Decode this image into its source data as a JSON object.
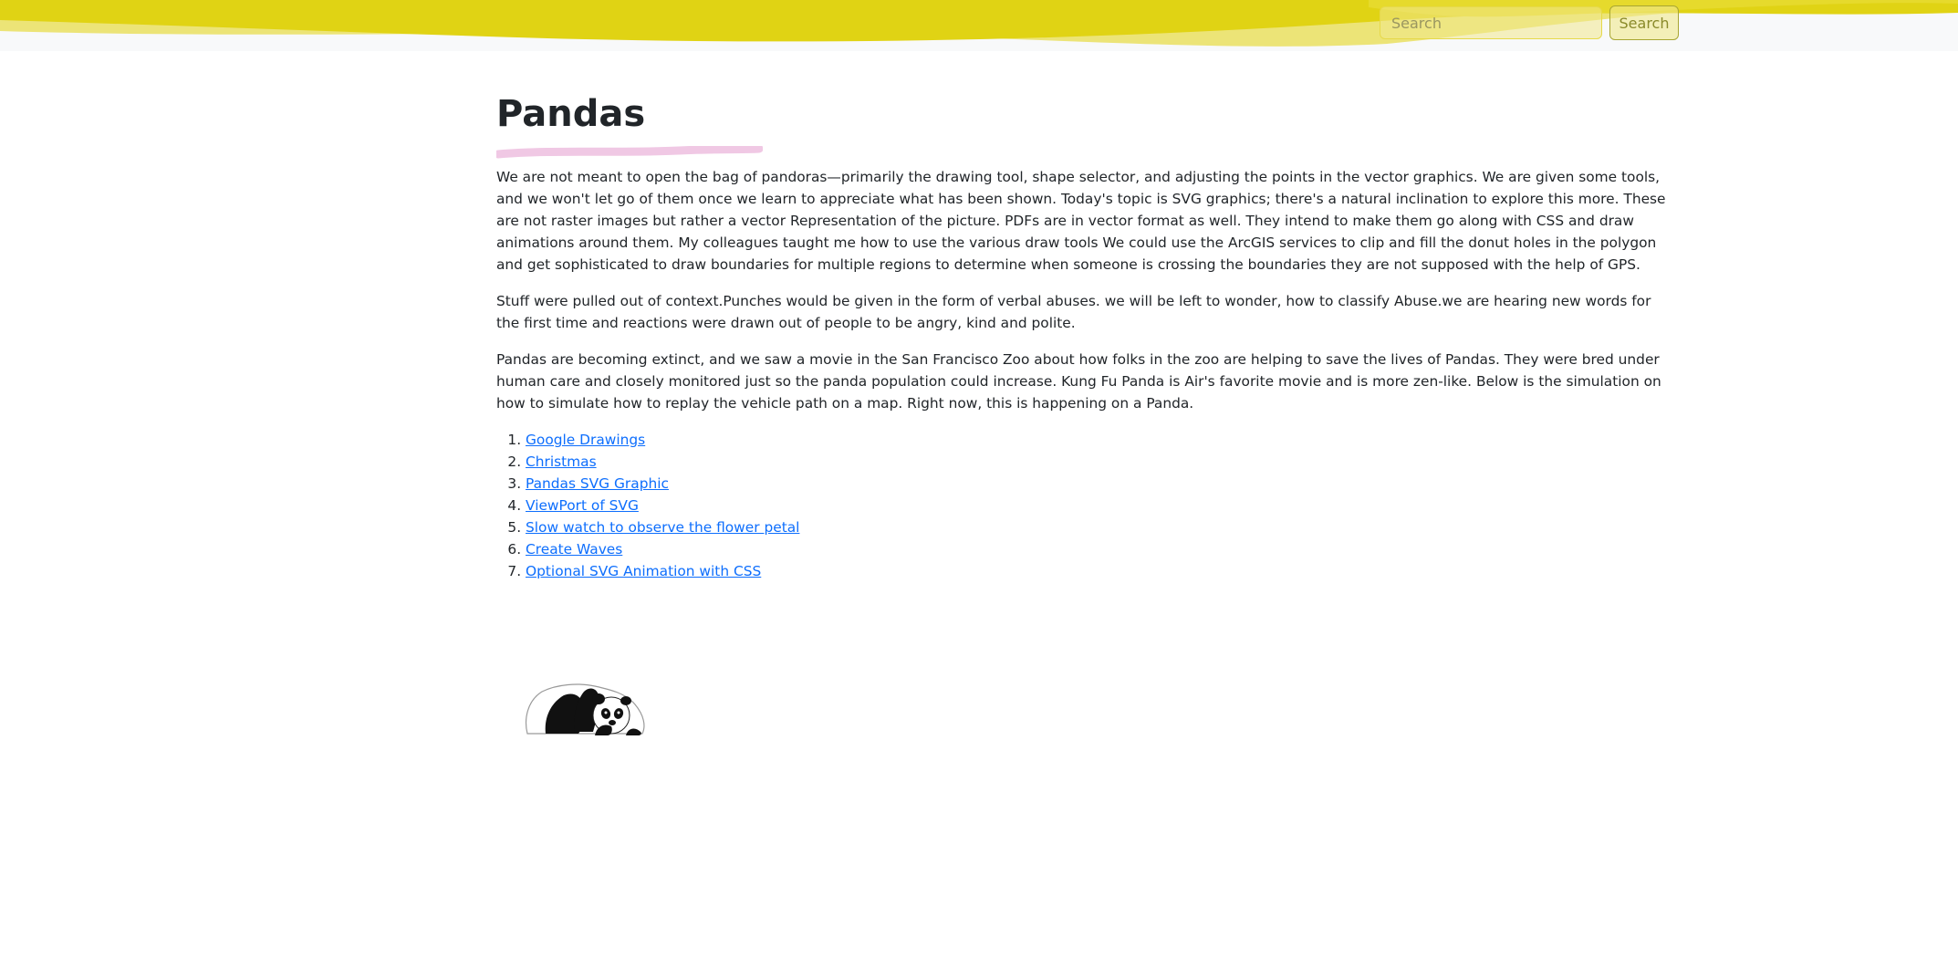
{
  "header": {
    "search_placeholder": "Search",
    "search_button_label": "Search",
    "colors": {
      "wave_primary": "#e0d314",
      "wave_light": "#ece477",
      "bar_background": "#f8f9fa"
    }
  },
  "main": {
    "title": "Pandas",
    "underline_color": "#f0c8e4",
    "paragraphs": [
      "We are not meant to open the bag of pandoras—primarily the drawing tool, shape selector, and adjusting the points in the vector graphics. We are given some tools, and we won't let go of them once we learn to appreciate what has been shown. Today's topic is SVG graphics; there's a natural inclination to explore this more. These are not raster images but rather a vector Representation of the picture. PDFs are in vector format as well. They intend to make them go along with CSS and draw animations around them. My colleagues taught me how to use the various draw tools We could use the ArcGIS services to clip and fill the donut holes in the polygon and get sophisticated to draw boundaries for multiple regions to determine when someone is crossing the boundaries they are not supposed with the help of GPS.",
      "Stuff were pulled out of context.Punches would be given in the form of verbal abuses. we will be left to wonder, how to classify Abuse.we are hearing new words for the first time and reactions were drawn out of people to be angry, kind and polite.",
      "Pandas are becoming extinct, and we saw a movie in the San Francisco Zoo about how folks in the zoo are helping to save the lives of Pandas. They were bred under human care and closely monitored just so the panda population could increase. Kung Fu Panda is Air's favorite movie and is more zen-like. Below is the simulation on how to simulate how to replay the vehicle path on a map. Right now, this is happening on a Panda."
    ],
    "links": [
      "Google Drawings",
      "Christmas",
      "Pandas SVG Graphic",
      "ViewPort of SVG",
      "Slow watch to observe the flower petal",
      "Create Waves",
      "Optional SVG Animation with CSS"
    ],
    "link_color": "#0d6efd",
    "illustration": "panda-illustration"
  }
}
